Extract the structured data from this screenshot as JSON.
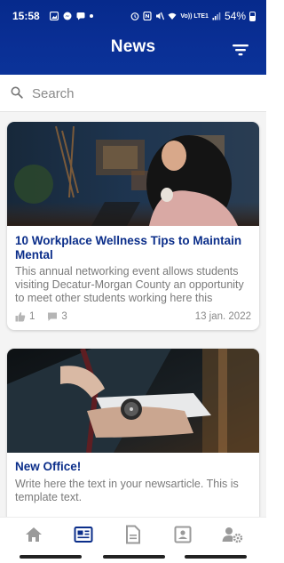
{
  "status_bar": {
    "time": "15:58",
    "network_label": "Vo)) LTE1",
    "battery": "54%"
  },
  "header": {
    "title": "News",
    "filter_icon": "filter-icon"
  },
  "search": {
    "placeholder": "Search",
    "value": ""
  },
  "articles": [
    {
      "title": "10 Workplace Wellness Tips to Maintain Mental",
      "excerpt": "This annual networking event allows students visiting Decatur-Morgan County an opportunity to meet other students working here this summer. ..",
      "likes": "1",
      "comments": "3",
      "date": "13 jan. 2022",
      "image": "woman-with-laptop-photo"
    },
    {
      "title": "New Office!",
      "excerpt": "Write here the text in your newsarticle. This is template text.",
      "image": "businessman-watch-photo"
    }
  ],
  "tabs": [
    {
      "name": "home",
      "icon": "home-icon",
      "active": false
    },
    {
      "name": "news",
      "icon": "newspaper-icon",
      "active": true
    },
    {
      "name": "documents",
      "icon": "document-icon",
      "active": false
    },
    {
      "name": "contacts",
      "icon": "contact-card-icon",
      "active": false
    },
    {
      "name": "settings",
      "icon": "user-settings-icon",
      "active": false
    }
  ],
  "colors": {
    "primary": "#0b2e8a",
    "header_bg": "#062a8c",
    "tab_active": "#0b2e8a",
    "tab_inactive": "#9a9a9a"
  }
}
